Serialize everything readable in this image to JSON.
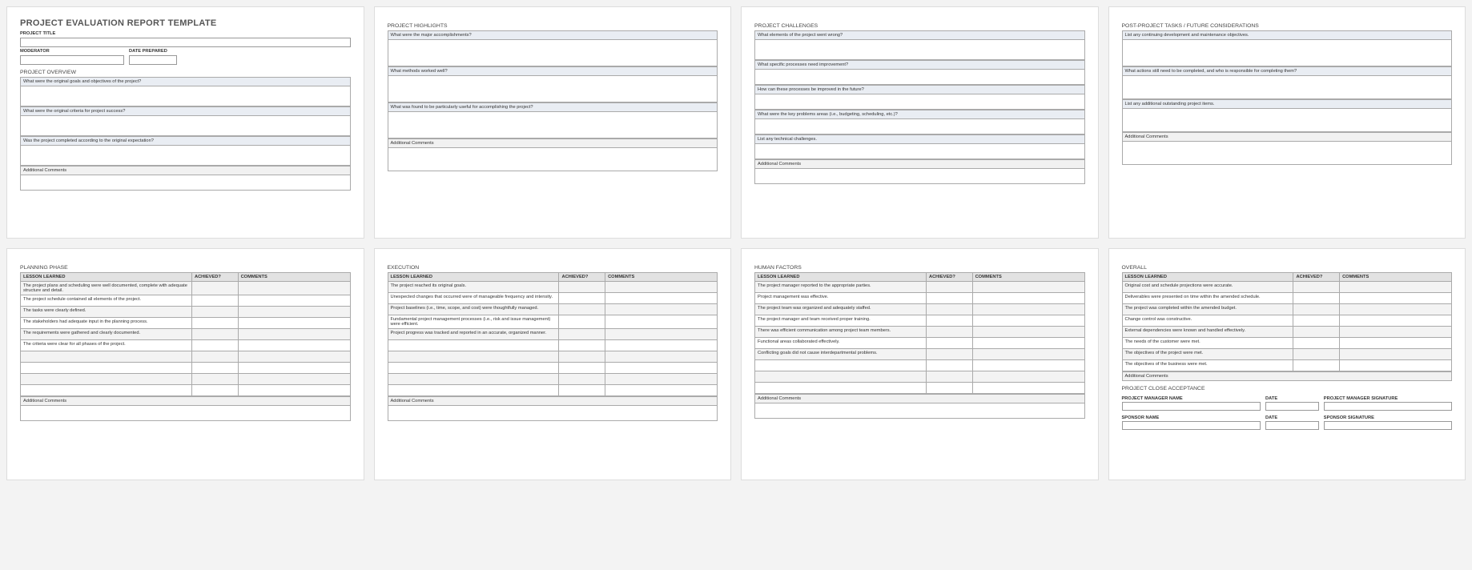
{
  "p1": {
    "title": "PROJECT EVALUATION REPORT TEMPLATE",
    "projectTitleLabel": "PROJECT TITLE",
    "moderatorLabel": "MODERATOR",
    "datePreparedLabel": "DATE PREPARED",
    "overview": "PROJECT OVERVIEW",
    "q1": "What were the original goals and objectives of the project?",
    "q2": "What were the original criteria for project success?",
    "q3": "Was the project completed according to the original expectation?",
    "addl": "Additional Comments"
  },
  "p2": {
    "heading": "PROJECT HIGHLIGHTS",
    "q1": "What were the major accomplishments?",
    "q2": "What methods worked well?",
    "q3": "What was found to be particularly useful for accomplishing the project?",
    "addl": "Additional Comments"
  },
  "p3": {
    "heading": "PROJECT CHALLENGES",
    "q1": "What elements of the project went wrong?",
    "q2": "What specific processes need improvement?",
    "q3": "How can these processes be improved in the future?",
    "q4": "What were the key problems areas (i.e., budgeting, scheduling, etc.)?",
    "q5": "List any technical challenges.",
    "addl": "Additional Comments"
  },
  "p4": {
    "heading": "POST-PROJECT TASKS / FUTURE CONSIDERATIONS",
    "q1": "List any continuing development and maintenance objectives.",
    "q2": "What actions still need to be completed, and who is responsible for completing them?",
    "q3": "List any additional outstanding project items.",
    "addl": "Additional Comments"
  },
  "cols": {
    "lesson": "LESSON LEARNED",
    "achieved": "ACHIEVED?",
    "comments": "COMMENTS"
  },
  "addl": "Additional Comments",
  "p5": {
    "heading": "PLANNING PHASE",
    "rows": [
      "The project plans and scheduling were well documented, complete with adequate structure and detail.",
      "The project schedule contained all elements of the project.",
      "The tasks were clearly defined.",
      "The stakeholders had adequate input in the planning process.",
      "The requirements were gathered and clearly documented.",
      "The criteria were clear for all phases of the project.",
      "",
      "",
      "",
      ""
    ]
  },
  "p6": {
    "heading": "EXECUTION",
    "rows": [
      "The project reached its original goals.",
      "Unexpected changes that occurred were of manageable frequency and intensity.",
      "Project baselines (i.e., time, scope, and cost) were thoughtfully managed.",
      "Fundamental project management processes (i.e., risk and issue management) were efficient.",
      "Project progress was tracked and reported in an accurate, organized manner.",
      "",
      "",
      "",
      "",
      ""
    ]
  },
  "p7": {
    "heading": "HUMAN FACTORS",
    "rows": [
      "The project manager reported to the appropriate parties.",
      "Project management was effective.",
      "The project team was organized and adequately staffed.",
      "The project manager and team received proper training.",
      "There was efficient communication among project team members.",
      "Functional areas collaborated effectively.",
      "Conflicting goals did not cause interdepartmental problems.",
      "",
      "",
      ""
    ]
  },
  "p8": {
    "heading": "OVERALL",
    "rows": [
      "Original cost and schedule projections were accurate.",
      "Deliverables were presented on time within the amended schedule.",
      "The project was completed within the amended budget.",
      "Change control was constructive.",
      "External dependencies were known and handled effectively.",
      "The needs of the customer were met.",
      "The objectives of the project were met.",
      "The objectives of the business were met."
    ],
    "addl": "Additional Comments",
    "closeHeading": "PROJECT CLOSE ACCEPTANCE",
    "pmName": "PROJECT MANAGER NAME",
    "date": "DATE",
    "pmSig": "PROJECT MANAGER SIGNATURE",
    "sponsorName": "SPONSOR NAME",
    "sponsorSig": "SPONSOR SIGNATURE"
  }
}
